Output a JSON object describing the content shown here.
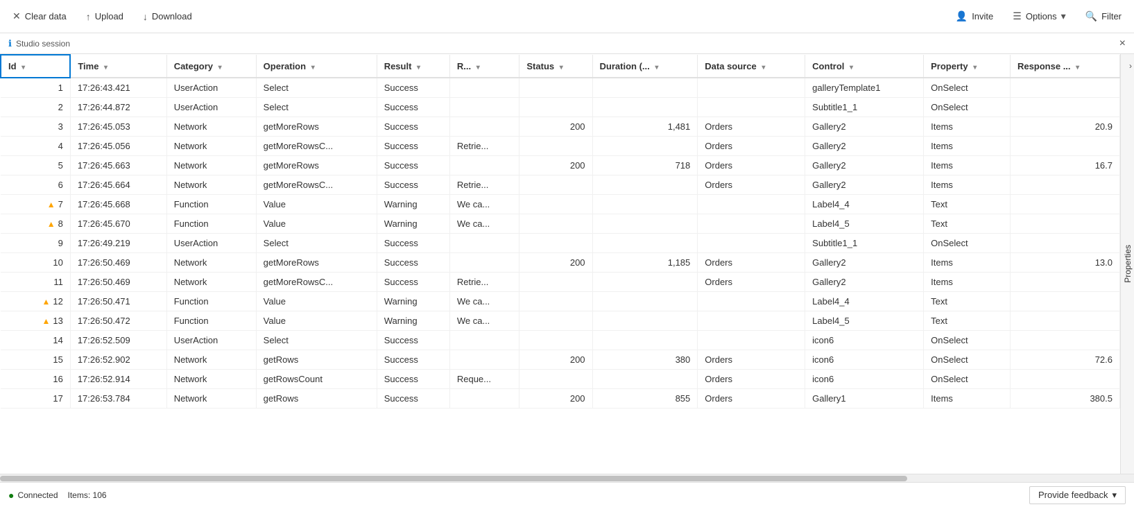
{
  "toolbar": {
    "clear_data_label": "Clear data",
    "upload_label": "Upload",
    "download_label": "Download",
    "invite_label": "Invite",
    "options_label": "Options",
    "filter_label": "Filter"
  },
  "session_bar": {
    "label": "Studio session",
    "close_label": "×"
  },
  "side_panel": {
    "label": "Properties",
    "arrow": "›"
  },
  "table": {
    "columns": [
      {
        "id": "id",
        "label": "Id",
        "sortable": true,
        "selected": true
      },
      {
        "id": "time",
        "label": "Time",
        "sortable": true
      },
      {
        "id": "category",
        "label": "Category",
        "sortable": true
      },
      {
        "id": "operation",
        "label": "Operation",
        "sortable": true
      },
      {
        "id": "result",
        "label": "Result",
        "sortable": true
      },
      {
        "id": "r",
        "label": "R...",
        "sortable": true
      },
      {
        "id": "status",
        "label": "Status",
        "sortable": true
      },
      {
        "id": "duration",
        "label": "Duration (...",
        "sortable": true
      },
      {
        "id": "datasource",
        "label": "Data source",
        "sortable": true
      },
      {
        "id": "control",
        "label": "Control",
        "sortable": true
      },
      {
        "id": "property",
        "label": "Property",
        "sortable": true
      },
      {
        "id": "response",
        "label": "Response ...",
        "sortable": true
      }
    ],
    "rows": [
      {
        "id": 1,
        "time": "17:26:43.421",
        "category": "UserAction",
        "operation": "Select",
        "result": "Success",
        "r": "",
        "status": "",
        "duration": "",
        "datasource": "",
        "control": "galleryTemplate1",
        "property": "OnSelect",
        "response": "",
        "warning": false
      },
      {
        "id": 2,
        "time": "17:26:44.872",
        "category": "UserAction",
        "operation": "Select",
        "result": "Success",
        "r": "",
        "status": "",
        "duration": "",
        "datasource": "",
        "control": "Subtitle1_1",
        "property": "OnSelect",
        "response": "",
        "warning": false
      },
      {
        "id": 3,
        "time": "17:26:45.053",
        "category": "Network",
        "operation": "getMoreRows",
        "result": "Success",
        "r": "",
        "status": "200",
        "duration": "1,481",
        "datasource": "Orders",
        "control": "Gallery2",
        "property": "Items",
        "response": "20.9",
        "warning": false
      },
      {
        "id": 4,
        "time": "17:26:45.056",
        "category": "Network",
        "operation": "getMoreRowsC...",
        "result": "Success",
        "r": "Retrie...",
        "status": "",
        "duration": "",
        "datasource": "Orders",
        "control": "Gallery2",
        "property": "Items",
        "response": "",
        "warning": false
      },
      {
        "id": 5,
        "time": "17:26:45.663",
        "category": "Network",
        "operation": "getMoreRows",
        "result": "Success",
        "r": "",
        "status": "200",
        "duration": "718",
        "datasource": "Orders",
        "control": "Gallery2",
        "property": "Items",
        "response": "16.7",
        "warning": false
      },
      {
        "id": 6,
        "time": "17:26:45.664",
        "category": "Network",
        "operation": "getMoreRowsC...",
        "result": "Success",
        "r": "Retrie...",
        "status": "",
        "duration": "",
        "datasource": "Orders",
        "control": "Gallery2",
        "property": "Items",
        "response": "",
        "warning": false
      },
      {
        "id": 7,
        "time": "17:26:45.668",
        "category": "Function",
        "operation": "Value",
        "result": "Warning",
        "r": "We ca...",
        "status": "",
        "duration": "",
        "datasource": "",
        "control": "Label4_4",
        "property": "Text",
        "response": "",
        "warning": true
      },
      {
        "id": 8,
        "time": "17:26:45.670",
        "category": "Function",
        "operation": "Value",
        "result": "Warning",
        "r": "We ca...",
        "status": "",
        "duration": "",
        "datasource": "",
        "control": "Label4_5",
        "property": "Text",
        "response": "",
        "warning": true
      },
      {
        "id": 9,
        "time": "17:26:49.219",
        "category": "UserAction",
        "operation": "Select",
        "result": "Success",
        "r": "",
        "status": "",
        "duration": "",
        "datasource": "",
        "control": "Subtitle1_1",
        "property": "OnSelect",
        "response": "",
        "warning": false
      },
      {
        "id": 10,
        "time": "17:26:50.469",
        "category": "Network",
        "operation": "getMoreRows",
        "result": "Success",
        "r": "",
        "status": "200",
        "duration": "1,185",
        "datasource": "Orders",
        "control": "Gallery2",
        "property": "Items",
        "response": "13.0",
        "warning": false
      },
      {
        "id": 11,
        "time": "17:26:50.469",
        "category": "Network",
        "operation": "getMoreRowsC...",
        "result": "Success",
        "r": "Retrie...",
        "status": "",
        "duration": "",
        "datasource": "Orders",
        "control": "Gallery2",
        "property": "Items",
        "response": "",
        "warning": false
      },
      {
        "id": 12,
        "time": "17:26:50.471",
        "category": "Function",
        "operation": "Value",
        "result": "Warning",
        "r": "We ca...",
        "status": "",
        "duration": "",
        "datasource": "",
        "control": "Label4_4",
        "property": "Text",
        "response": "",
        "warning": true
      },
      {
        "id": 13,
        "time": "17:26:50.472",
        "category": "Function",
        "operation": "Value",
        "result": "Warning",
        "r": "We ca...",
        "status": "",
        "duration": "",
        "datasource": "",
        "control": "Label4_5",
        "property": "Text",
        "response": "",
        "warning": true
      },
      {
        "id": 14,
        "time": "17:26:52.509",
        "category": "UserAction",
        "operation": "Select",
        "result": "Success",
        "r": "",
        "status": "",
        "duration": "",
        "datasource": "",
        "control": "icon6",
        "property": "OnSelect",
        "response": "",
        "warning": false
      },
      {
        "id": 15,
        "time": "17:26:52.902",
        "category": "Network",
        "operation": "getRows",
        "result": "Success",
        "r": "",
        "status": "200",
        "duration": "380",
        "datasource": "Orders",
        "control": "icon6",
        "property": "OnSelect",
        "response": "72.6",
        "warning": false
      },
      {
        "id": 16,
        "time": "17:26:52.914",
        "category": "Network",
        "operation": "getRowsCount",
        "result": "Success",
        "r": "Reque...",
        "status": "",
        "duration": "",
        "datasource": "Orders",
        "control": "icon6",
        "property": "OnSelect",
        "response": "",
        "warning": false
      },
      {
        "id": 17,
        "time": "17:26:53.784",
        "category": "Network",
        "operation": "getRows",
        "result": "Success",
        "r": "",
        "status": "200",
        "duration": "855",
        "datasource": "Orders",
        "control": "Gallery1",
        "property": "Items",
        "response": "380.5",
        "warning": false
      }
    ]
  },
  "status_bar": {
    "connected_label": "Connected",
    "items_label": "Items: 106",
    "feedback_label": "Provide feedback"
  }
}
